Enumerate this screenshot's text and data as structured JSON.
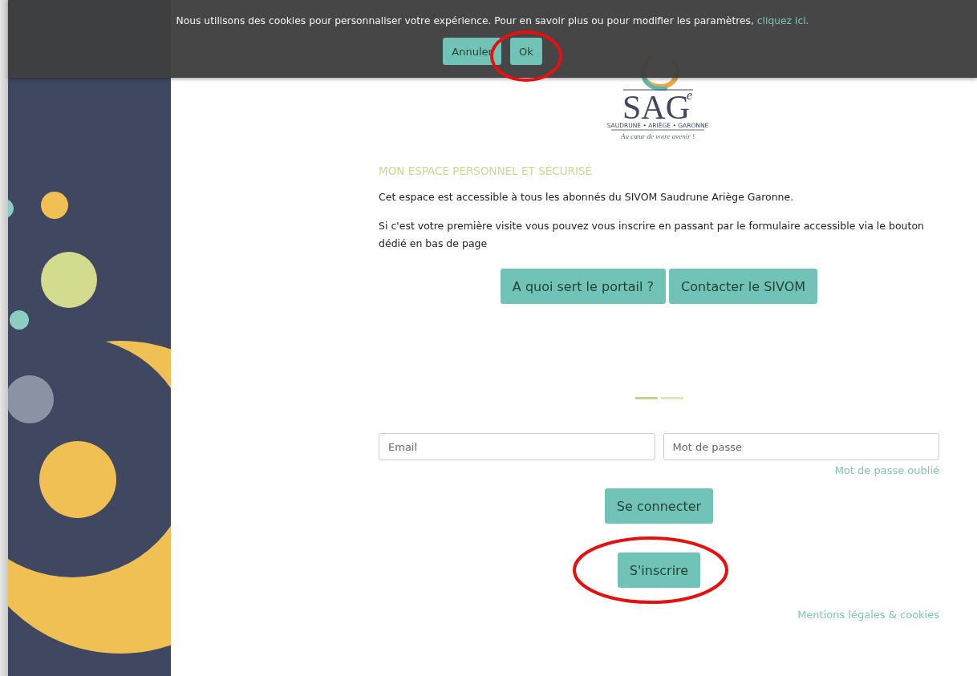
{
  "cookie_banner": {
    "message": "Nous utilisons des cookies pour personnaliser votre expérience. Pour en savoir plus ou pour modifier les paramètres,",
    "link": "cliquez ici.",
    "buttons": [
      {
        "label": "Annuler",
        "circled": false
      },
      {
        "label": "Ok",
        "circled": true
      }
    ]
  },
  "logo": {
    "letters": "SAG",
    "superscript": "e",
    "subtitle": "SAUDRUNE • ARIÈGE • GARONNE",
    "tagline": "Au cœur de votre avenir !"
  },
  "heading": "MON ESPACE PERSONNEL ET SÉCURISÉ",
  "paragraphs": [
    "Cet espace est accessible à tous les abonnés du SIVOM Saudrune Ariège Garonne.",
    "Si c'est votre première visite vous pouvez vous inscrire en passant par le formulaire accessible via le bouton dédié en bas de page"
  ],
  "info_buttons": [
    "A quoi sert le portail ?",
    "Contacter le SIVOM"
  ],
  "carousel_indicators": [
    {
      "selected": true
    },
    {
      "selected": false
    }
  ],
  "login": {
    "email": {
      "placeholder": "Email"
    },
    "password": {
      "placeholder": "Mot de passe"
    },
    "forgot_link": "Mot de passe oublié",
    "submit": "Se connecter",
    "register": "S'inscrire",
    "register_circled": true
  },
  "footer_link": "Mentions légales & cookies"
}
